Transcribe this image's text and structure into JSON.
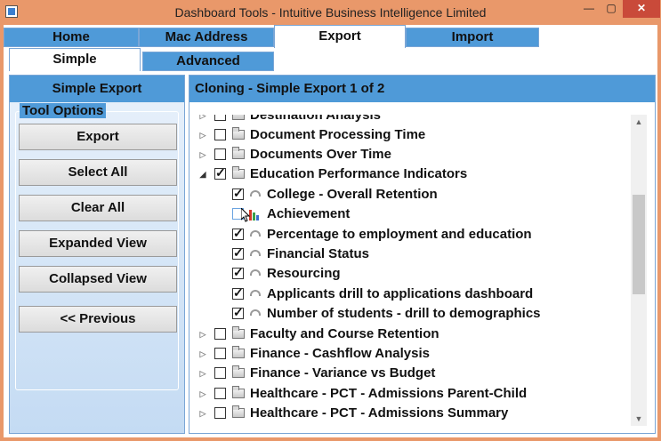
{
  "window": {
    "title": "Dashboard Tools - Intuitive Business Intelligence Limited",
    "min": "—",
    "max": "▢",
    "close": "✕"
  },
  "tabs": [
    {
      "label": "Home"
    },
    {
      "label": "Mac Address"
    },
    {
      "label": "Export"
    },
    {
      "label": "Import"
    }
  ],
  "subtabs": [
    {
      "label": "Simple"
    },
    {
      "label": "Advanced"
    }
  ],
  "left": {
    "header": "Simple Export",
    "group_label": "Tool Options",
    "buttons": {
      "export": "Export",
      "select_all": "Select All",
      "clear_all": "Clear All",
      "expanded_view": "Expanded View",
      "collapsed_view": "Collapsed View",
      "previous": "<< Previous"
    }
  },
  "right": {
    "header": "Cloning - Simple Export 1 of 2",
    "tree": [
      {
        "label": "Destination Analysis",
        "level": 0,
        "checked": false,
        "icon": "folder-icon"
      },
      {
        "label": "Document Processing Time",
        "level": 0,
        "checked": false,
        "icon": "folder-icon"
      },
      {
        "label": "Documents Over Time",
        "level": 0,
        "checked": false,
        "icon": "folder-icon"
      },
      {
        "label": "Education Performance Indicators",
        "level": 0,
        "checked": true,
        "expanded": true,
        "icon": "folder-icon"
      },
      {
        "label": "College - Overall Retention",
        "level": 1,
        "checked": true,
        "icon": "gauge-icon"
      },
      {
        "label": "Achievement",
        "level": 1,
        "checked": false,
        "icon": "bar-chart-icon"
      },
      {
        "label": "Percentage to employment and education",
        "level": 1,
        "checked": true,
        "icon": "gauge-icon"
      },
      {
        "label": "Financial Status",
        "level": 1,
        "checked": true,
        "icon": "gauge-icon"
      },
      {
        "label": "Resourcing",
        "level": 1,
        "checked": true,
        "icon": "gauge-icon"
      },
      {
        "label": "Applicants drill to applications dashboard",
        "level": 1,
        "checked": true,
        "icon": "gauge-icon"
      },
      {
        "label": "Number of students - drill to demographics",
        "level": 1,
        "checked": true,
        "icon": "gauge-icon"
      },
      {
        "label": "Faculty and Course Retention",
        "level": 0,
        "checked": false,
        "icon": "folder-icon"
      },
      {
        "label": "Finance - Cashflow Analysis",
        "level": 0,
        "checked": false,
        "icon": "folder-icon"
      },
      {
        "label": "Finance - Variance vs Budget",
        "level": 0,
        "checked": false,
        "icon": "folder-icon"
      },
      {
        "label": "Healthcare - PCT - Admissions Parent-Child",
        "level": 0,
        "checked": false,
        "icon": "folder-icon"
      },
      {
        "label": "Healthcare - PCT - Admissions Summary",
        "level": 0,
        "checked": false,
        "icon": "folder-icon"
      }
    ]
  },
  "colors": {
    "accent": "#4f9ad8",
    "frame": "#e9986a",
    "close": "#c94a3a"
  }
}
